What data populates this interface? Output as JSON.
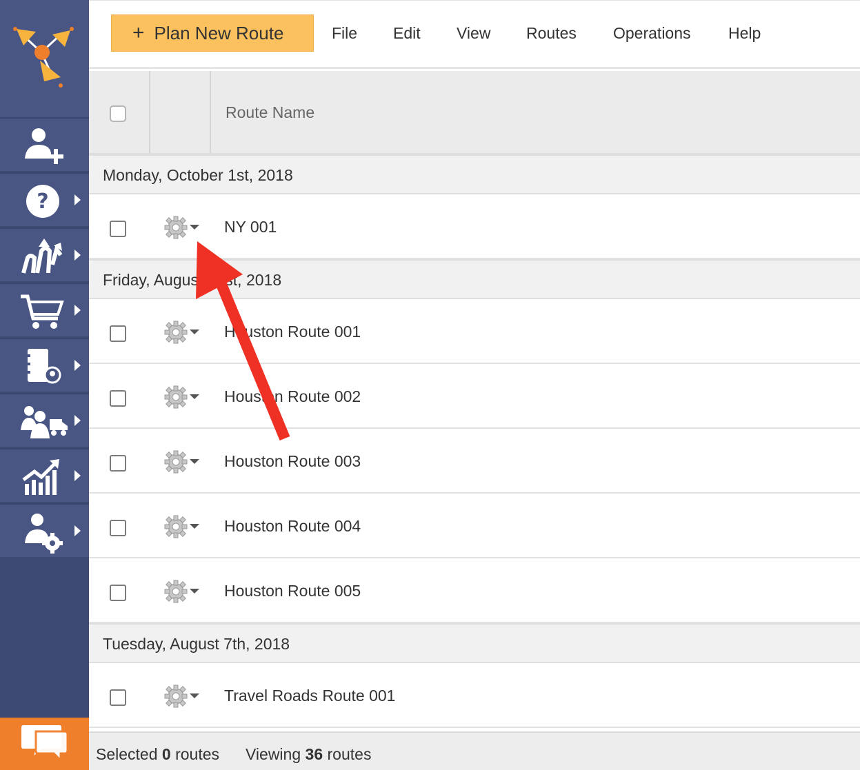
{
  "menubar": {
    "plan_button": "Plan New Route",
    "items": [
      "File",
      "Edit",
      "View",
      "Routes",
      "Operations",
      "Help"
    ]
  },
  "sidebar": {
    "items": [
      {
        "icon": "user-add-icon",
        "has_submenu": false
      },
      {
        "icon": "help-icon",
        "has_submenu": true
      },
      {
        "icon": "routes-icon",
        "has_submenu": true
      },
      {
        "icon": "cart-icon",
        "has_submenu": true
      },
      {
        "icon": "address-book-icon",
        "has_submenu": true
      },
      {
        "icon": "team-vehicle-icon",
        "has_submenu": true
      },
      {
        "icon": "analytics-icon",
        "has_submenu": true
      },
      {
        "icon": "user-settings-icon",
        "has_submenu": true
      }
    ],
    "chat_icon": "chat-icon",
    "colors": {
      "sidebar": "#495683",
      "accent": "#f07f2c",
      "button": "#fcc15f",
      "arrow": "#ee3124"
    }
  },
  "table": {
    "column_header": "Route Name",
    "groups": [
      {
        "label": "Monday, October 1st, 2018",
        "routes": [
          "NY 001"
        ]
      },
      {
        "label": "Friday, August 31st, 2018",
        "routes": [
          "Houston Route 001",
          "Houston Route 002",
          "Houston Route 003",
          "Houston Route 004",
          "Houston Route 005"
        ]
      },
      {
        "label": "Tuesday, August 7th, 2018",
        "routes": [
          "Travel Roads Route 001"
        ]
      }
    ]
  },
  "footer": {
    "selected_prefix": "Selected",
    "selected_count": "0",
    "selected_suffix": "routes",
    "viewing_prefix": "Viewing",
    "viewing_count": "36",
    "viewing_suffix": "routes"
  }
}
